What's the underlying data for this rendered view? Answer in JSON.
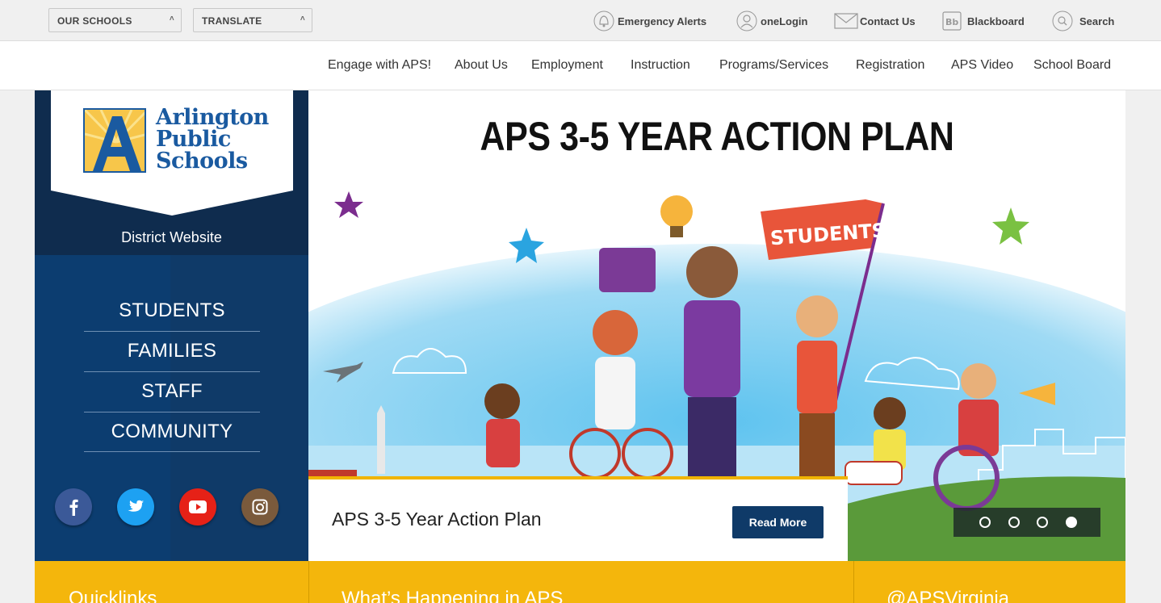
{
  "utility": {
    "schools_label": "OUR SCHOOLS",
    "translate_label": "TRANSLATE",
    "links": {
      "emergency": "Emergency Alerts",
      "onelogin": "oneLogin",
      "contact": "Contact Us",
      "blackboard": "Blackboard",
      "search": "Search"
    }
  },
  "nav": [
    "Engage with APS!",
    "About Us",
    "Employment",
    "Instruction",
    "Programs/Services",
    "Registration",
    "APS Video",
    "School Board"
  ],
  "sidebar": {
    "logo_lines": [
      "Arlington",
      "Public",
      "Schools"
    ],
    "district": "District Website",
    "links": [
      "STUDENTS",
      "FAMILIES",
      "STAFF",
      "COMMUNITY"
    ]
  },
  "hero": {
    "title": "APS 3-5 YEAR ACTION PLAN",
    "banner": "STUDENTS",
    "caption": "APS 3-5 Year Action Plan",
    "read_more": "Read More",
    "slides": 4,
    "active_slide": 4
  },
  "bottom": {
    "quicklinks": "Quicklinks",
    "happening": "What’s Happening in APS",
    "twitter": "@APSVirginia"
  },
  "colors": {
    "navy": "#0f2c4e",
    "blue": "#0c3c6e",
    "accent_yellow": "#f4b60c",
    "facebook": "#3b5998",
    "twitter": "#1da1f2",
    "youtube": "#e62117",
    "instagram": "#7a5a3c"
  }
}
